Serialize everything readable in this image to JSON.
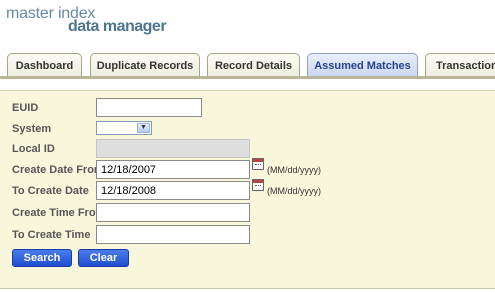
{
  "logo": {
    "line1": "master index",
    "line2": "data manager"
  },
  "tabs": [
    {
      "label": "Dashboard",
      "active": false
    },
    {
      "label": "Duplicate Records",
      "active": false
    },
    {
      "label": "Record Details",
      "active": false
    },
    {
      "label": "Assumed Matches",
      "active": true
    },
    {
      "label": "Transactions",
      "active": false
    }
  ],
  "form": {
    "euid": {
      "label": "EUID",
      "value": ""
    },
    "system": {
      "label": "System",
      "value": ""
    },
    "local_id": {
      "label": "Local ID",
      "value": ""
    },
    "create_date_from": {
      "label": "Create Date From",
      "value": "12/18/2007",
      "hint": "(MM/dd/yyyy)"
    },
    "to_create_date": {
      "label": "To Create Date",
      "value": "12/18/2008",
      "hint": "(MM/dd/yyyy)"
    },
    "create_time_from": {
      "label": "Create Time From",
      "value": ""
    },
    "to_create_time": {
      "label": "To Create Time",
      "value": ""
    }
  },
  "buttons": {
    "search": "Search",
    "clear": "Clear"
  },
  "colors": {
    "panel_bg": "#f8f7dc",
    "active_tab_text": "#27428a",
    "button_blue": "#2857d8"
  }
}
